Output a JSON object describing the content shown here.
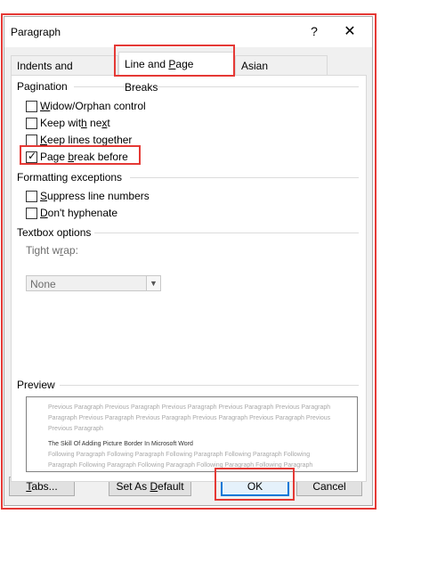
{
  "dialog": {
    "title": "Paragraph",
    "help": "?",
    "close": "✕"
  },
  "tabs": [
    {
      "label": "Indents and Spacing",
      "active": false
    },
    {
      "label": "Line and Page Breaks",
      "active": true
    },
    {
      "label": "Asian Typography",
      "active": false
    }
  ],
  "pagination": {
    "heading": "Pagination",
    "options": [
      {
        "label": "Widow/Orphan control",
        "checked": false
      },
      {
        "label": "Keep with next",
        "checked": false
      },
      {
        "label": "Keep lines together",
        "checked": false
      },
      {
        "label": "Page break before",
        "checked": true
      }
    ]
  },
  "formatting": {
    "heading": "Formatting exceptions",
    "options": [
      {
        "label": "Suppress line numbers",
        "checked": false
      },
      {
        "label": "Don't hyphenate",
        "checked": false
      }
    ]
  },
  "textbox": {
    "heading": "Textbox options",
    "tight_wrap_label": "Tight wrap:",
    "tight_wrap_value": "None"
  },
  "preview": {
    "heading": "Preview",
    "previous_lines": [
      "Previous Paragraph Previous Paragraph Previous Paragraph Previous Paragraph Previous Paragraph",
      "Paragraph Previous Paragraph Previous Paragraph Previous Paragraph Previous Paragraph Previous",
      "Previous Paragraph"
    ],
    "main_line": "The Skill Of Adding Picture Border In Microsoft Word",
    "following_lines": [
      "Following Paragraph Following Paragraph Following Paragraph Following Paragraph Following",
      "Paragraph Following Paragraph Following Paragraph Following Paragraph Following Paragraph"
    ]
  },
  "buttons": {
    "tabs": "Tabs...",
    "set_default": "Set As Default",
    "ok": "OK",
    "cancel": "Cancel"
  },
  "highlight_color": "#e53935"
}
